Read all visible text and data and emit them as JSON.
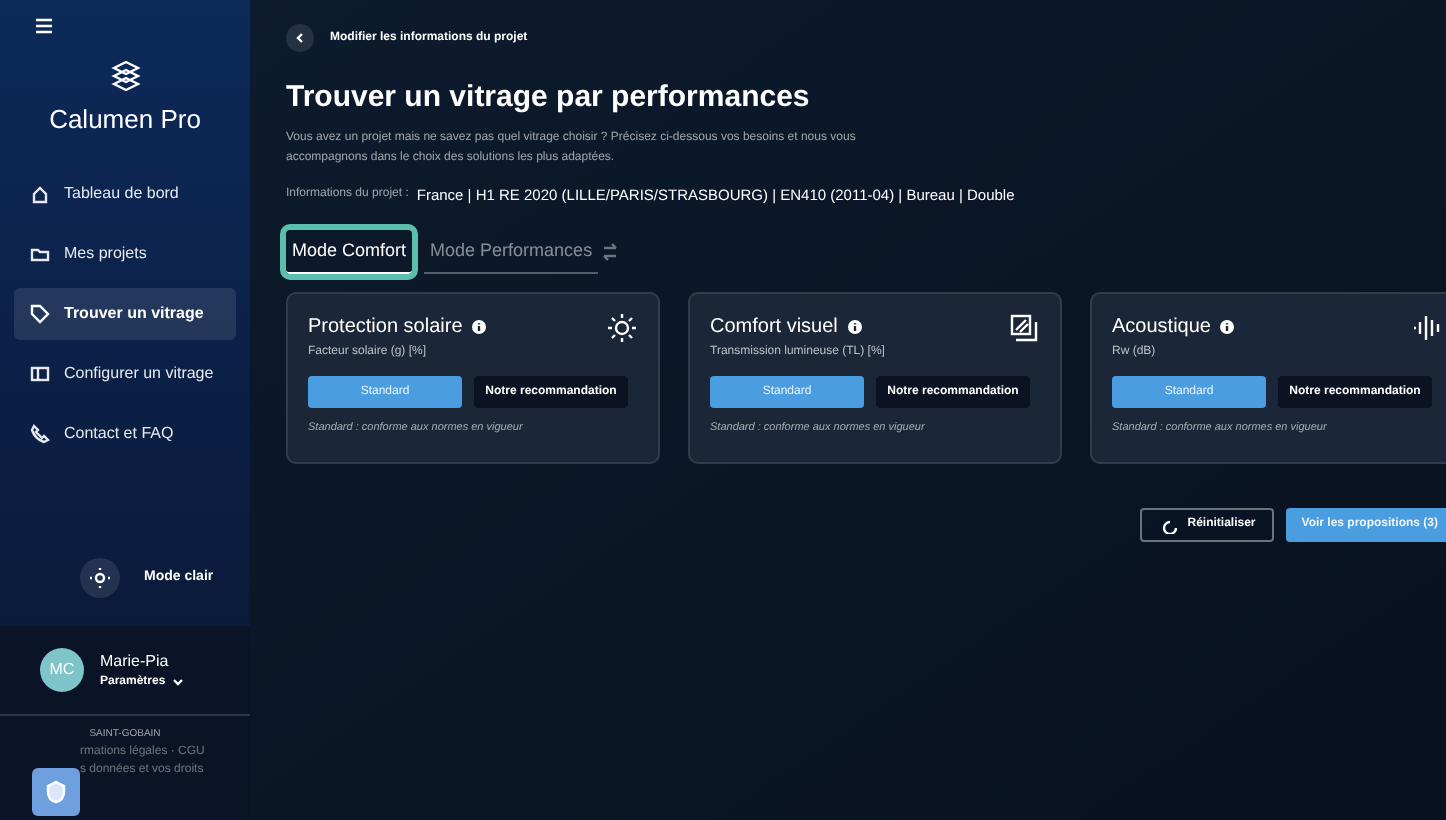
{
  "sidebar": {
    "brand": "Calumen Pro",
    "items": [
      {
        "label": "Tableau de bord",
        "selected": false
      },
      {
        "label": "Mes projets",
        "selected": false
      },
      {
        "label": "Trouver un vitrage",
        "selected": true
      },
      {
        "label": "Configurer un vitrage",
        "selected": false
      },
      {
        "label": "Contact et FAQ",
        "selected": false
      }
    ],
    "theme_toggle": "Mode clair",
    "user": {
      "initials": "MC",
      "name": "Marie-Pia",
      "menu": "Paramètres"
    },
    "footer": {
      "logo": "SAINT-GOBAIN",
      "lines": [
        "rmations légales · CGU",
        "s données et vos droits"
      ]
    }
  },
  "back_link": "Modifier les informations du projet",
  "title": "Trouver un vitrage par performances",
  "intro": "Vous avez un projet mais ne savez pas quel vitrage choisir ? Précisez ci-dessous vos besoins et nous vous accompagnons dans le choix des solutions les plus adaptées.",
  "project_info": {
    "label": "Informations du projet :",
    "value": "France | H1 RE 2020 (LILLE/PARIS/STRASBOURG) | EN410 (2011-04) | Bureau | Double"
  },
  "tabs": [
    {
      "label": "Mode Comfort",
      "selected": true
    },
    {
      "label": "Mode Performances",
      "selected": false
    }
  ],
  "cards": [
    {
      "title": "Protection solaire",
      "subtitle": "Facteur solaire (g) [%]",
      "options": [
        {
          "label": "Standard",
          "selected": true
        },
        {
          "label": "Notre recommandation",
          "selected": false
        }
      ],
      "note": "Standard : conforme aux normes en vigueur"
    },
    {
      "title": "Comfort visuel",
      "subtitle": "Transmission lumineuse (TL) [%]",
      "options": [
        {
          "label": "Standard",
          "selected": true
        },
        {
          "label": "Notre recommandation",
          "selected": false
        }
      ],
      "note": "Standard : conforme aux normes en vigueur"
    },
    {
      "title": "Acoustique",
      "subtitle": "Rw (dB)",
      "options": [
        {
          "label": "Standard",
          "selected": true
        },
        {
          "label": "Notre recommandation",
          "selected": false
        }
      ],
      "note": "Standard : conforme aux normes en vigueur"
    }
  ],
  "actions": {
    "reset": "Réinitialiser",
    "submit": "Voir les propositions (3)"
  }
}
